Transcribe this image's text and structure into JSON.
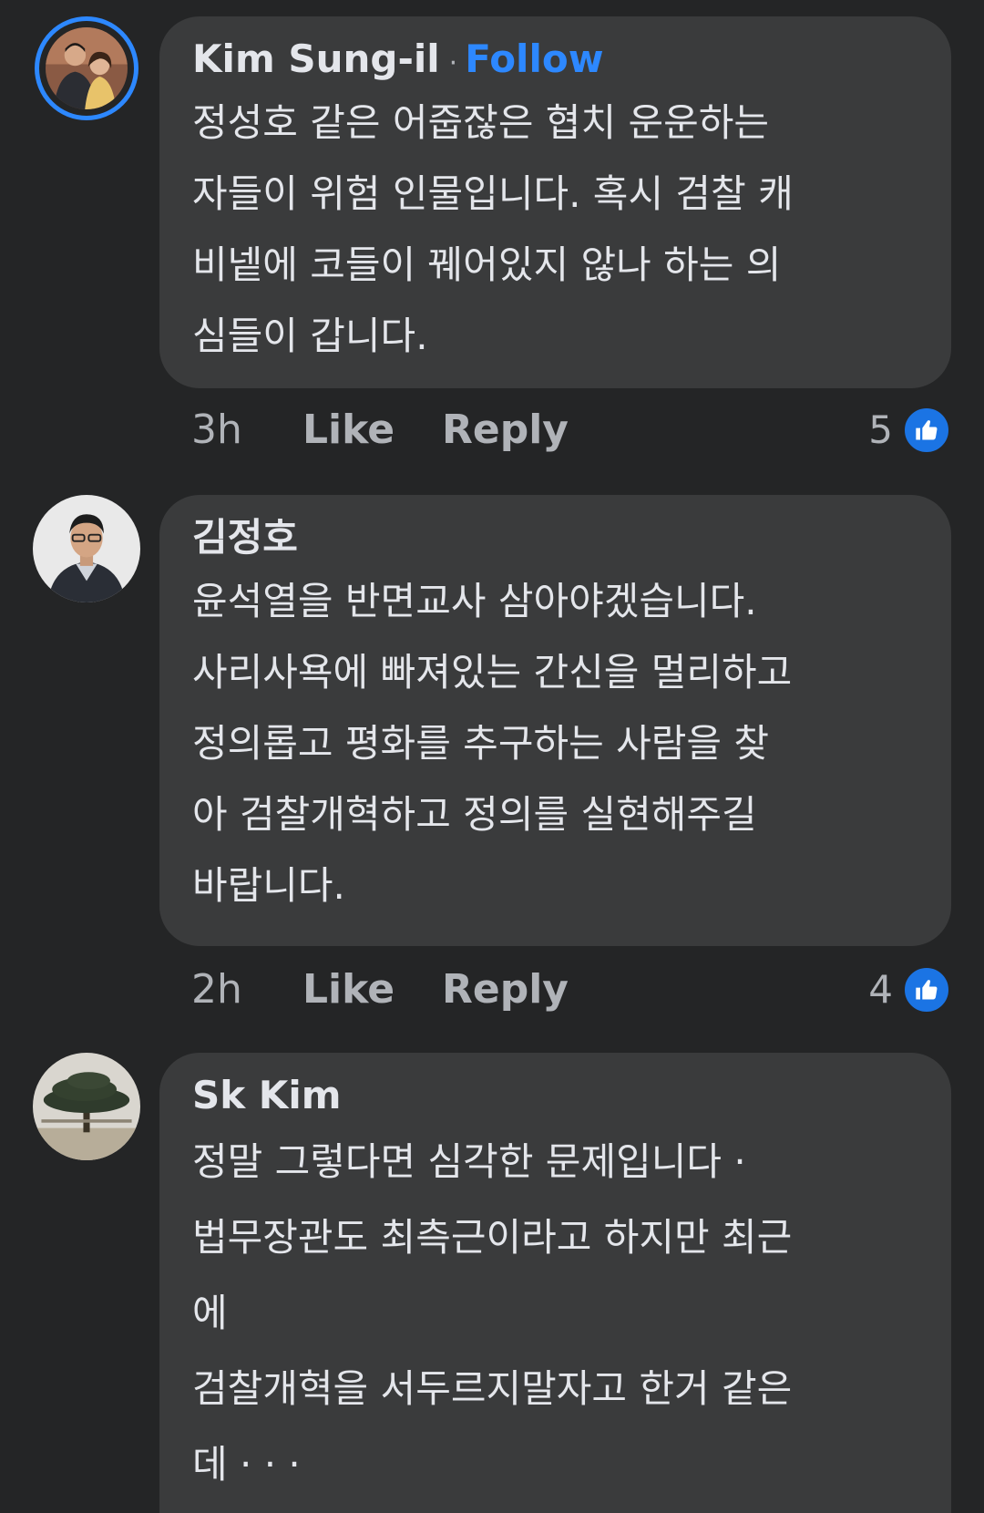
{
  "comments": [
    {
      "author": "Kim Sung-il",
      "separator": "·",
      "follow_label": "Follow",
      "lines": [
        "정성호 같은 어줍잖은 협치 운운하는",
        "자들이 위험 인물입니다. 혹시 검찰 캐",
        "비넽에 코들이 꿰어있지 않나 하는 의",
        "심들이 갑니다."
      ],
      "time": "3h",
      "like_label": "Like",
      "reply_label": "Reply",
      "reaction_count": "5",
      "reaction_icon": "thumbs-up-icon",
      "avatar_ring": true
    },
    {
      "author": "김정호",
      "lines": [
        "윤석열을 반면교사 삼아야겠습니다.",
        "사리사욕에 빠져있는 간신을 멀리하고",
        "정의롭고 평화를 추구하는 사람을 찾",
        "아 검찰개혁하고 정의를 실현해주길",
        "바랍니다."
      ],
      "time": "2h",
      "like_label": "Like",
      "reply_label": "Reply",
      "reaction_count": "4",
      "reaction_icon": "thumbs-up-icon"
    },
    {
      "author": "Sk Kim",
      "lines": [
        "정말 그렇다면 심각한 문제입니다 ·",
        "법무장관도 최측근이라고 하지만 최근",
        "에",
        "검찰개혁을 서두르지말자고 한거 같은",
        "데 · · ·"
      ]
    }
  ],
  "colors": {
    "background": "#242526",
    "bubble": "#3a3b3c",
    "text": "#e4e6eb",
    "secondary_text": "#b0b3b8",
    "accent": "#2d88ff",
    "like_badge": "#1b74e4"
  }
}
